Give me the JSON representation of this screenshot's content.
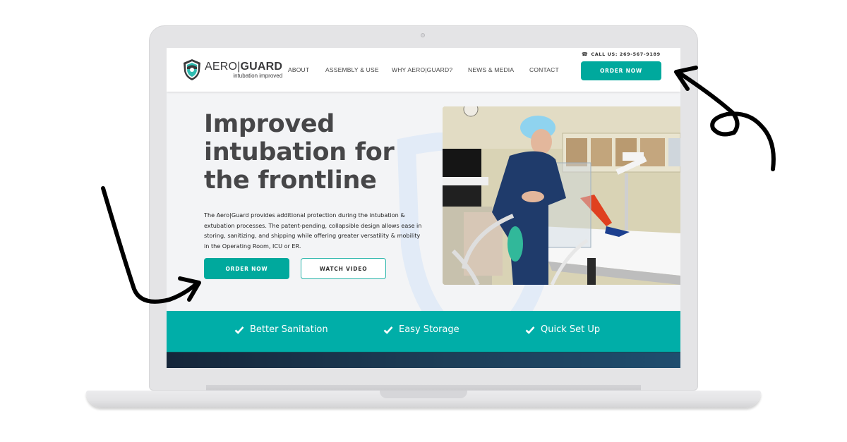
{
  "header": {
    "logo": {
      "word_light": "AERO",
      "separator": "|",
      "word_bold": "GUARD",
      "tagline": "intubation improved",
      "icon": "shield-logo-icon"
    },
    "nav": [
      {
        "label": "ABOUT"
      },
      {
        "label": "ASSEMBLY & USE"
      },
      {
        "label": "WHY AERO|GUARD?"
      },
      {
        "label": "NEWS & MEDIA"
      },
      {
        "label": "CONTACT"
      }
    ],
    "call_us": {
      "icon": "phone-icon",
      "label": "CALL US: 269-567-9189"
    },
    "order_button": "ORDER NOW"
  },
  "hero": {
    "headline_lines": [
      "Improved",
      "intubation for",
      "the frontline"
    ],
    "description": "The Aero|Guard  provides additional protection during the intubation & extubation processes. The patent-pending, collapsible design allows ease in storing, sanitizing, and shipping while offering greater versatility & mobility in the Operating Room, ICU or ER.",
    "primary_button": "ORDER NOW",
    "secondary_button": "WATCH VIDEO",
    "photo_alt": "Clinician demonstrating the AeroGuard intubation shield in an operating room"
  },
  "features": [
    {
      "icon": "check-icon",
      "label": "Better Sanitation"
    },
    {
      "icon": "check-icon",
      "label": "Easy Storage"
    },
    {
      "icon": "check-icon",
      "label": "Quick Set Up"
    }
  ],
  "colors": {
    "accent": "#00a99d",
    "band": "#00aea8",
    "heading": "#464648",
    "dark_band": "#1d3e58"
  }
}
